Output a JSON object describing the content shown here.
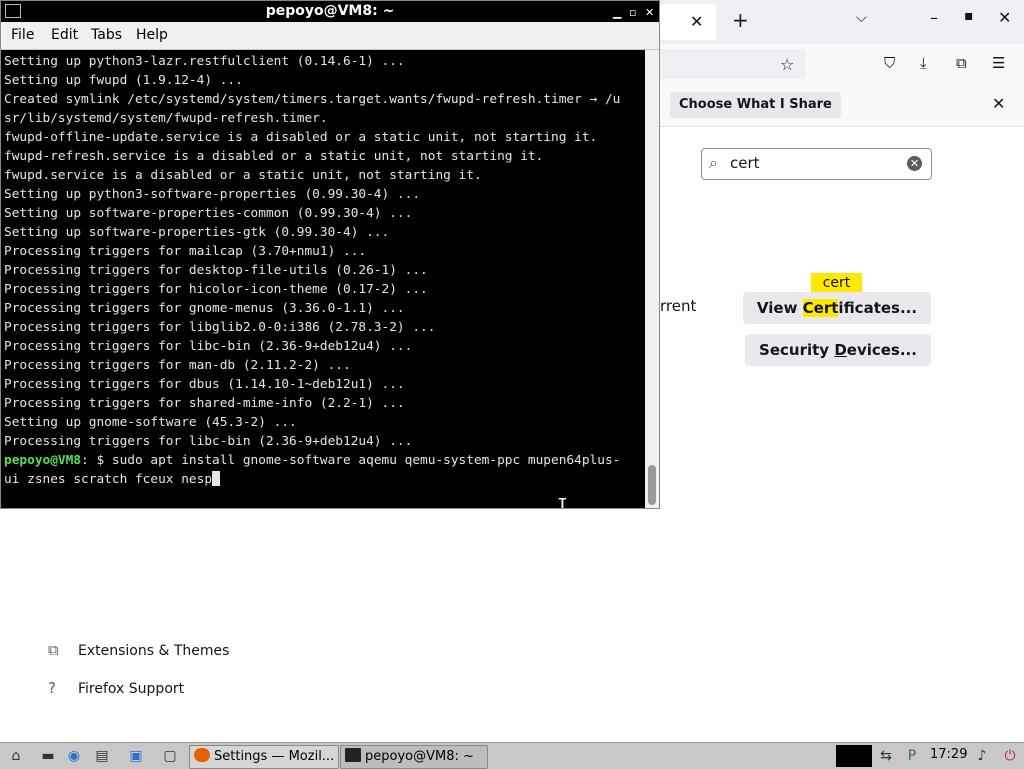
{
  "firefox": {
    "tab_close": "✕",
    "new_tab": "+",
    "list_tabs": "⌵",
    "win_min": "–",
    "win_max": "▪",
    "win_close": "✕",
    "toolbar_icons": [
      "pocket-icon",
      "download-icon",
      "extensions-icon",
      "menu-icon"
    ],
    "notice_button": "Choose What I Share",
    "notice_close": "✕",
    "search_value": "cert",
    "partial_text": "rrent",
    "tooltip": "cert",
    "view_certs_pre": "View ",
    "view_certs_hl": "Cert",
    "view_certs_post": "ificates...",
    "security_pre": "Security ",
    "security_hl": "D",
    "security_post": "evices...",
    "footer": {
      "extensions": "Extensions & Themes",
      "support": "Firefox Support"
    }
  },
  "terminal": {
    "title": "pepoyo@VM8: ~",
    "menu": [
      "File",
      "Edit",
      "Tabs",
      "Help"
    ],
    "lines": [
      "Setting up python3-lazr.restfulclient (0.14.6-1) ...",
      "Setting up fwupd (1.9.12-4) ...",
      "Created symlink /etc/systemd/system/timers.target.wants/fwupd-refresh.timer → /u",
      "sr/lib/systemd/system/fwupd-refresh.timer.",
      "fwupd-offline-update.service is a disabled or a static unit, not starting it.",
      "fwupd-refresh.service is a disabled or a static unit, not starting it.",
      "fwupd.service is a disabled or a static unit, not starting it.",
      "Setting up python3-software-properties (0.99.30-4) ...",
      "Setting up software-properties-common (0.99.30-4) ...",
      "Setting up software-properties-gtk (0.99.30-4) ...",
      "Processing triggers for mailcap (3.70+nmu1) ...",
      "Processing triggers for desktop-file-utils (0.26-1) ...",
      "Processing triggers for hicolor-icon-theme (0.17-2) ...",
      "Processing triggers for gnome-menus (3.36.0-1.1) ...",
      "Processing triggers for libglib2.0-0:i386 (2.78.3-2) ...",
      "Processing triggers for libc-bin (2.36-9+deb12u4) ...",
      "Processing triggers for man-db (2.11.2-2) ...",
      "Processing triggers for dbus (1.14.10-1~deb12u1) ...",
      "Processing triggers for shared-mime-info (2.2-1) ...",
      "Setting up gnome-software (45.3-2) ...",
      "Processing triggers for libc-bin (2.36-9+deb12u4) ..."
    ],
    "prompt": "pepoyo@VM8",
    "prompt_rest": ": $ sudo apt install gnome-software aqemu qemu-system-ppc mupen64plus-",
    "command_cont": "ui zsnes scratch fceux nesp"
  },
  "taskbar": {
    "tasks": [
      "Settings — Mozil...",
      "pepoyo@VM8: ~"
    ],
    "clock": "17:29"
  }
}
